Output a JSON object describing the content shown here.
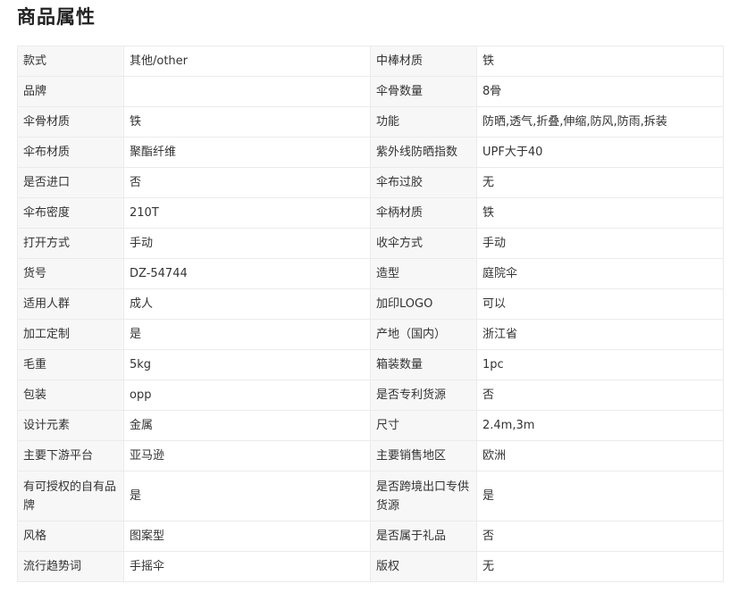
{
  "section": {
    "title": "商品属性"
  },
  "attributes": [
    {
      "k1": "款式",
      "v1": "其他/other",
      "k2": "中棒材质",
      "v2": "铁"
    },
    {
      "k1": "品牌",
      "v1": "",
      "k2": "伞骨数量",
      "v2": "8骨"
    },
    {
      "k1": "伞骨材质",
      "v1": "铁",
      "k2": "功能",
      "v2": "防晒,透气,折叠,伸缩,防风,防雨,拆装"
    },
    {
      "k1": "伞布材质",
      "v1": "聚酯纤维",
      "k2": "紫外线防晒指数",
      "v2": "UPF大于40"
    },
    {
      "k1": "是否进口",
      "v1": "否",
      "k2": "伞布过胶",
      "v2": "无"
    },
    {
      "k1": "伞布密度",
      "v1": "210T",
      "k2": "伞柄材质",
      "v2": "铁"
    },
    {
      "k1": "打开方式",
      "v1": "手动",
      "k2": "收伞方式",
      "v2": "手动"
    },
    {
      "k1": "货号",
      "v1": "DZ-54744",
      "k2": "造型",
      "v2": "庭院伞"
    },
    {
      "k1": "适用人群",
      "v1": "成人",
      "k2": "加印LOGO",
      "v2": "可以"
    },
    {
      "k1": "加工定制",
      "v1": "是",
      "k2": "产地（国内）",
      "v2": "浙江省"
    },
    {
      "k1": "毛重",
      "v1": "5kg",
      "k2": "箱装数量",
      "v2": "1pc"
    },
    {
      "k1": "包装",
      "v1": "opp",
      "k2": "是否专利货源",
      "v2": "否"
    },
    {
      "k1": "设计元素",
      "v1": "金属",
      "k2": "尺寸",
      "v2": "2.4m,3m"
    },
    {
      "k1": "主要下游平台",
      "v1": "亚马逊",
      "k2": "主要销售地区",
      "v2": "欧洲"
    },
    {
      "k1": "有可授权的自有品牌",
      "v1": "是",
      "k2": "是否跨境出口专供货源",
      "v2": "是"
    },
    {
      "k1": "风格",
      "v1": "图案型",
      "k2": "是否属于礼品",
      "v2": "否"
    },
    {
      "k1": "流行趋势词",
      "v1": "手摇伞",
      "k2": "版权",
      "v2": "无"
    }
  ]
}
